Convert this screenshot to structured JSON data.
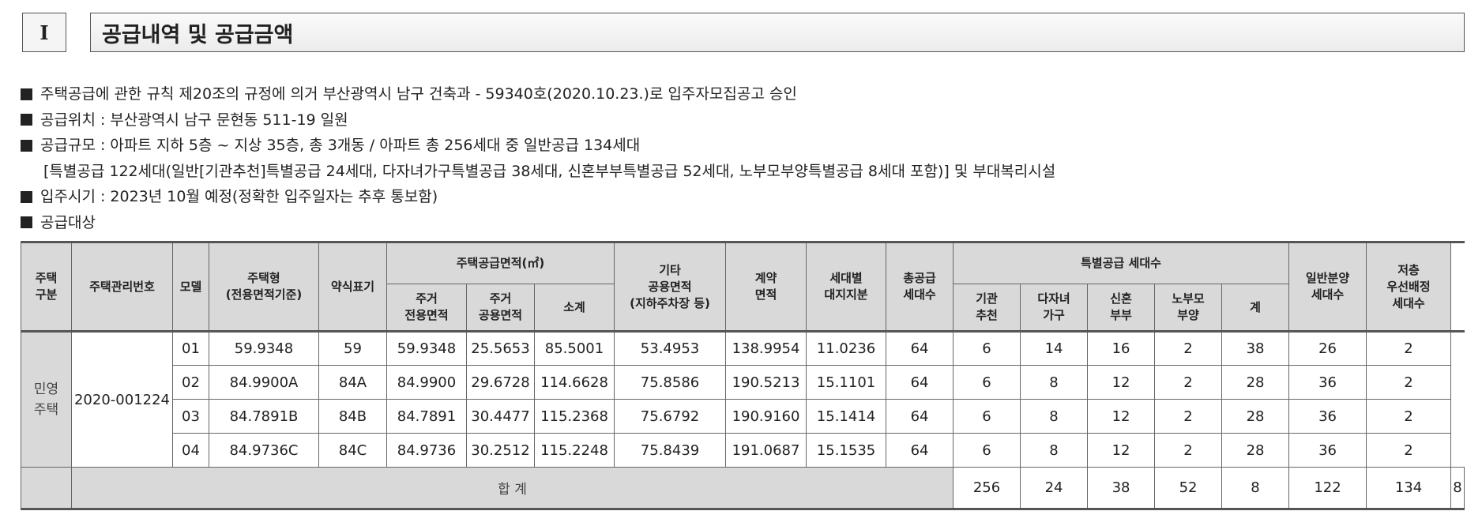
{
  "section": {
    "number": "I",
    "title": "공급내역 및 공급금액"
  },
  "info_lines": [
    "주택공급에 관한 규칙 제20조의 규정에 의거 부산광역시 남구 건축과 - 59340호(2020.10.23.)로 입주자모집공고 승인",
    "공급위치 : 부산광역시 남구 문현동 511-19 일원",
    "공급규모 : 아파트 지하 5층 ~ 지상 35층, 총 3개동 / 아파트 총 256세대 중 일반공급 134세대",
    "[특별공급 122세대(일반[기관추천]특별공급 24세대, 다자녀가구특별공급 38세대, 신혼부부특별공급 52세대, 노부모부양특별공급 8세대 포함)] 및 부대복리시설",
    "입주시기 : 2023년 10월 예정(정확한 입주일자는 추후 통보함)",
    "공급대상"
  ],
  "table": {
    "headers": {
      "house_type": "주택\n구분",
      "mgmt_no": "주택관리번호",
      "model": "모델",
      "house_model": "주택형\n(전용면적기준)",
      "abbr": "약식표기",
      "supply_area": "주택공급면적(㎡)",
      "exclusive_area": "주거\n전용면적",
      "common_area": "주거\n공용면적",
      "subtotal": "소계",
      "other_common": "기타\n공용면적\n(지하주차장 등)",
      "contract_area": "계약\n면적",
      "land_share": "세대별\n대지지분",
      "total_units": "총공급\n세대수",
      "special_units": "특별공급 세대수",
      "sp_inst": "기관\n추천",
      "sp_multi": "다자녀\n가구",
      "sp_newlywed": "신혼\n부부",
      "sp_elderly": "노부모\n부양",
      "sp_sum": "계",
      "general_units": "일반분양\n세대수",
      "low_floor": "저층\n우선배정\n세대수"
    },
    "house_type_value": "민영\n주택",
    "mgmt_no_value": "2020-001224",
    "rows": [
      [
        "01",
        "59.9348",
        "59",
        "59.9348",
        "25.5653",
        "85.5001",
        "53.4953",
        "138.9954",
        "11.0236",
        "64",
        "6",
        "14",
        "16",
        "2",
        "38",
        "26",
        "2"
      ],
      [
        "02",
        "84.9900A",
        "84A",
        "84.9900",
        "29.6728",
        "114.6628",
        "75.8586",
        "190.5213",
        "15.1101",
        "64",
        "6",
        "8",
        "12",
        "2",
        "28",
        "36",
        "2"
      ],
      [
        "03",
        "84.7891B",
        "84B",
        "84.7891",
        "30.4477",
        "115.2368",
        "75.6792",
        "190.9160",
        "15.1414",
        "64",
        "6",
        "8",
        "12",
        "2",
        "28",
        "36",
        "2"
      ],
      [
        "04",
        "84.9736C",
        "84C",
        "84.9736",
        "30.2512",
        "115.2248",
        "75.8439",
        "191.0687",
        "15.1535",
        "64",
        "6",
        "8",
        "12",
        "2",
        "28",
        "36",
        "2"
      ]
    ],
    "total_label": "합 계",
    "totals": [
      "256",
      "24",
      "38",
      "52",
      "8",
      "122",
      "134",
      "8"
    ]
  }
}
